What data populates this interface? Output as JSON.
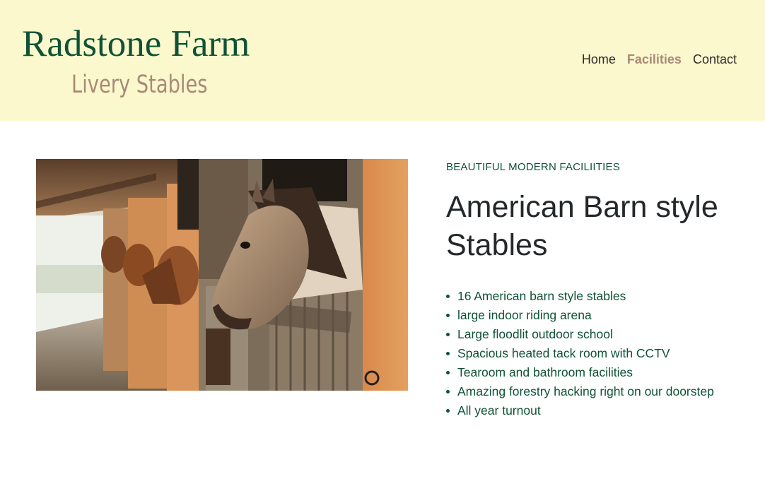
{
  "header": {
    "title": "Radstone Farm",
    "subtitle": "Livery Stables",
    "nav": [
      {
        "label": "Home",
        "active": false
      },
      {
        "label": "Facilities",
        "active": true
      },
      {
        "label": "Contact",
        "active": false
      }
    ]
  },
  "main": {
    "image": {
      "subject": "horses looking out of wooden barn stable doors"
    },
    "eyebrow": "BEAUTIFUL MODERN FACILIITIES",
    "headline": "American Barn style Stables",
    "features": [
      "16 American barn style stables",
      "large indoor riding arena",
      "Large floodlit outdoor school",
      "Spacious heated tack room with CCTV",
      "Tearoom and bathroom facilities",
      "Amazing forestry hacking right on our doorstep",
      "All year turnout"
    ]
  },
  "colors": {
    "header_bg": "#fcf8cd",
    "brand_green": "#0f5236",
    "accent_taupe": "#a88a78",
    "text_dark": "#24282a"
  }
}
